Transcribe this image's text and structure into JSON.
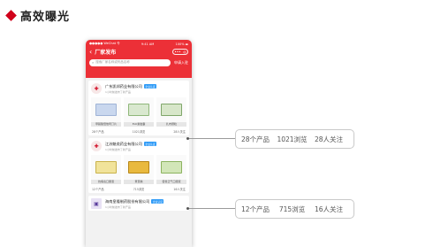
{
  "slide": {
    "title": "高效曝光"
  },
  "phone": {
    "status": {
      "carrier": "●●●●● WeChat 令",
      "time": "9:41 AM",
      "battery": "100% ▬"
    },
    "nav": {
      "back": "‹",
      "title": "厂家发布",
      "capsule": [
        "•••",
        "◎"
      ]
    },
    "search": {
      "placeholder": "搜索厂家名称或药品名称",
      "apply_label": "申请入驻"
    },
    "cards": [
      {
        "logo": "✚",
        "company": "广东凯邦药业有限公司",
        "badge": "企业认证",
        "subtitle": "1小时前发布了新产品",
        "products": [
          {
            "name": "甲磺酸倍他司汀片",
            "color": "#c9d7ee"
          },
          {
            "name": "ELK素胶囊",
            "color": "#d9e8cf"
          },
          {
            "name": "扎布颗粒",
            "color": "#d7e6c9"
          }
        ],
        "stats": [
          "28个产品",
          "1021浏览",
          "28人关注"
        ]
      },
      {
        "logo": "✚",
        "company": "江苏魁奕药业有限公司",
        "badge": "企业认证",
        "subtitle": "1小时前发布了新产品",
        "products": [
          {
            "name": "抗病毒口服液",
            "color": "#f1e39a"
          },
          {
            "name": "黄芪精",
            "color": "#e9b93e"
          },
          {
            "name": "藿香正气口服液",
            "color": "#d2e6b8"
          }
        ],
        "stats": [
          "12个产品",
          "715浏览",
          "16人关注"
        ]
      },
      {
        "logo": "▣",
        "company": "海南皇隆制药股份有限公司",
        "badge": "企业认证",
        "subtitle": "1小时前发布了新产品"
      }
    ]
  },
  "callouts": [
    {
      "products": "28个产品",
      "views": "1021浏览",
      "followers": "28人关注"
    },
    {
      "products": "12个产品",
      "views": "715浏览",
      "followers": "16人关注"
    }
  ]
}
